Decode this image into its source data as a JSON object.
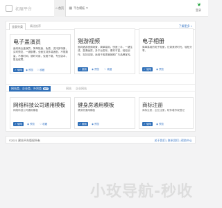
{
  "header": {
    "logo_text": "初展平台",
    "nav_home": "首页",
    "nav_templates": "平台模板",
    "login_text": "登录"
  },
  "section1": {
    "tab_active": "全部分类",
    "tab_other": "精选推荐",
    "more_link": "了解更多 »",
    "cards": [
      {
        "title": "电子盖演员",
        "desc": "面向商业盖演员，简单快速，免费，支持多场景，实时预览，一键部署，全面支持多端适配，不限数量，不限时间，随时可用，免费下载，专业版本，售后保障。",
        "btn_primary": "使用",
        "btn_secondary": "预览",
        "btn_tertiary": "收藏"
      },
      {
        "title": "猎游视频",
        "desc": "面向猎游视频场景，简单易用，快速上手，一键生成，高清画质，多平台发布，素材丰富，轻松创作，支持定制，适用于各类营销推广与品牌宣传。",
        "btn_primary": "使用",
        "btn_secondary": "预览",
        "btn_tertiary": "收藏"
      },
      {
        "title": "电子相册",
        "desc": "简单易用的电子相册，记录美好时光，轻松分享。",
        "btn_primary": "使用",
        "btn_secondary": "预览"
      }
    ]
  },
  "section2": {
    "tab_active": "网站类、企业类、外贸类",
    "tab_badge": "推荐",
    "tab_other1": "网站",
    "tab_other2": "企业网站",
    "cards": [
      {
        "title": "网络科技公司通用模板",
        "sub": "网络科技公司通用模板",
        "btn_primary": "使用",
        "btn_secondary": "预览",
        "btn_tertiary": "收藏"
      },
      {
        "title": "健身房通用模板",
        "sub": "健身房通用模板",
        "btn_primary": "使用",
        "btn_secondary": "预览"
      },
      {
        "title": "商标注册",
        "sub": "商标注册，企业注册，软件著作权登记",
        "btn_primary": "使用",
        "btn_secondary": "预览"
      }
    ]
  },
  "footer": {
    "left_text": "©2021 建站平台版权所有",
    "right_text": "关于我们 | 联系我们 | 帮助中心"
  },
  "watermark": "小玫导航-秒收",
  "colors": {
    "accent": "#2f6fb8",
    "link": "#3b78c6",
    "brand_leaf": "#20a33c"
  }
}
